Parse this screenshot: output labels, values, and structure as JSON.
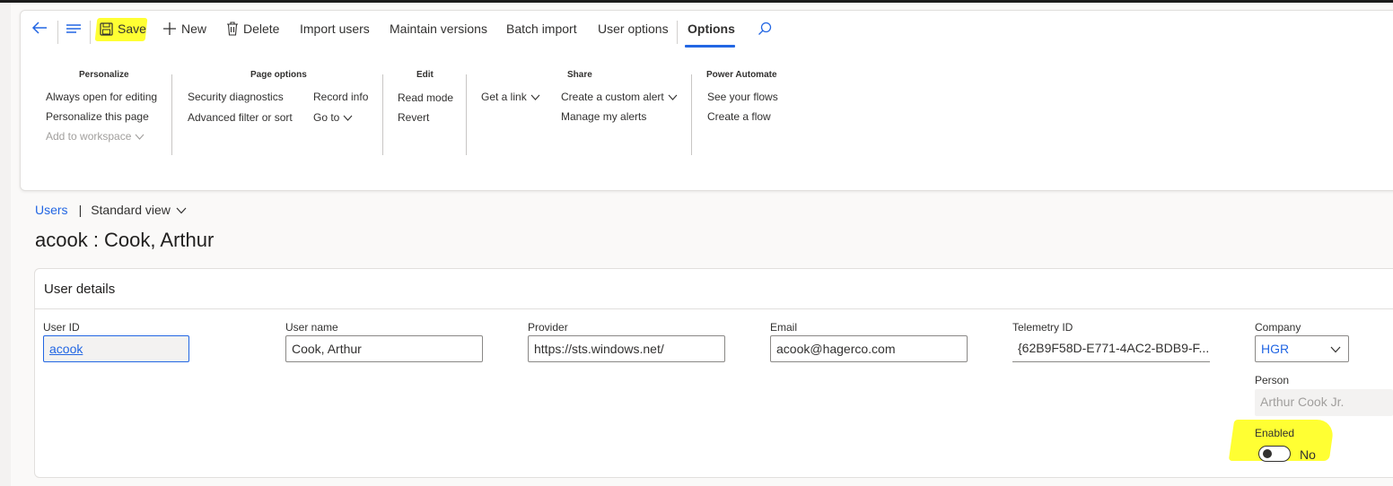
{
  "actions": {
    "save": "Save",
    "new": "New",
    "delete": "Delete",
    "import_users": "Import users",
    "maintain_versions": "Maintain versions",
    "batch_import": "Batch import",
    "user_options": "User options",
    "options": "Options"
  },
  "ribbon": {
    "personalize": {
      "title": "Personalize",
      "items": [
        "Always open for editing",
        "Personalize this page",
        "Add to workspace"
      ]
    },
    "page_options": {
      "title": "Page options",
      "items": [
        "Security diagnostics",
        "Advanced filter or sort",
        "Record info",
        "Go to"
      ]
    },
    "edit": {
      "title": "Edit",
      "items": [
        "Read mode",
        "Revert"
      ]
    },
    "share": {
      "title": "Share",
      "items": [
        "Get a link",
        "Create a custom alert",
        "Manage my alerts"
      ]
    },
    "power_automate": {
      "title": "Power Automate",
      "items": [
        "See your flows",
        "Create a flow"
      ]
    }
  },
  "breadcrumb": {
    "link": "Users",
    "separator": "|",
    "view": "Standard view"
  },
  "page_title": "acook : Cook, Arthur",
  "user_details": {
    "header": "User details",
    "fields": {
      "user_id": {
        "label": "User ID",
        "value": "acook"
      },
      "user_name": {
        "label": "User name",
        "value": "Cook, Arthur"
      },
      "provider": {
        "label": "Provider",
        "value": "https://sts.windows.net/"
      },
      "email": {
        "label": "Email",
        "value": "acook@hagerco.com"
      },
      "telemetry_id": {
        "label": "Telemetry ID",
        "value": "{62B9F58D-E771-4AC2-BDB9-F..."
      },
      "company": {
        "label": "Company",
        "value": "HGR"
      },
      "person": {
        "label": "Person",
        "value": "Arthur Cook Jr."
      },
      "enabled": {
        "label": "Enabled",
        "value": "No"
      }
    }
  },
  "colors": {
    "accent": "#2266e3",
    "highlight": "#ffff33"
  }
}
